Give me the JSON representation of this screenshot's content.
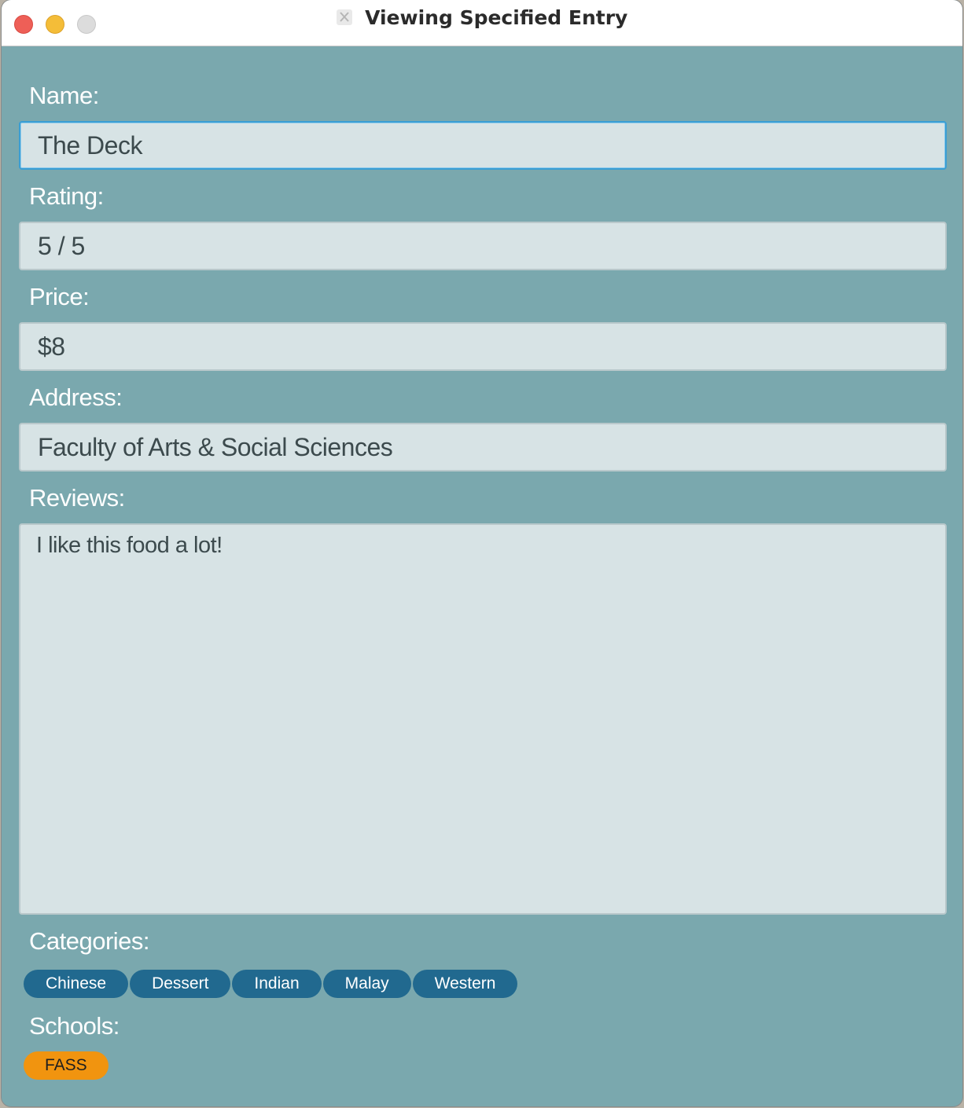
{
  "window": {
    "title": "Viewing Specified Entry"
  },
  "form": {
    "name_label": "Name:",
    "name_value": "The Deck",
    "rating_label": "Rating:",
    "rating_value": "5 / 5",
    "price_label": "Price:",
    "price_value": "$8",
    "address_label": "Address:",
    "address_value": "Faculty of Arts & Social Sciences",
    "reviews_label": "Reviews:",
    "reviews_value": "I like this food a lot!",
    "categories_label": "Categories:",
    "categories": [
      "Chinese",
      "Dessert",
      "Indian",
      "Malay",
      "Western"
    ],
    "schools_label": "Schools:",
    "schools": [
      "FASS"
    ]
  },
  "colors": {
    "background": "#7aa8ae",
    "field_bg": "#d7e3e5",
    "category_tag": "#21698f",
    "school_tag": "#f1940f",
    "focus_ring": "#3a9ed4"
  }
}
